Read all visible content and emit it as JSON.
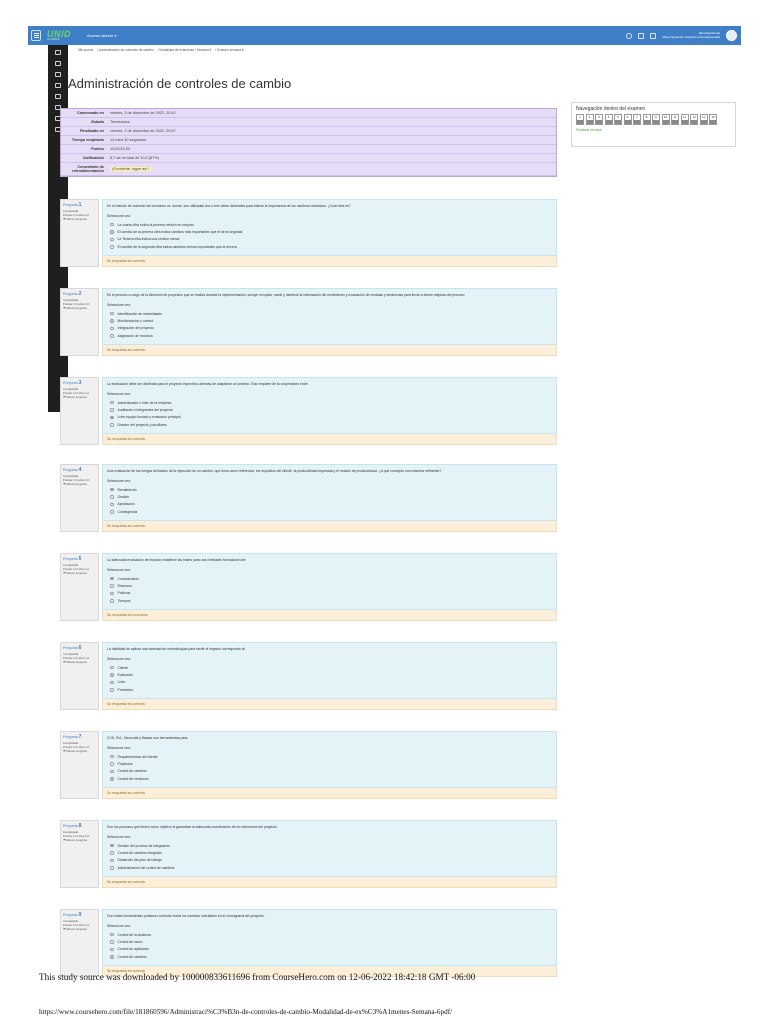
{
  "topnav": {
    "logo": "UNID",
    "logo_sub": "ALUMNOS",
    "direct_access": "Acceso directo ▾",
    "user_name": "Mis Asignaturas",
    "user_sub": "Mayo Navarrete Jessica Lorena Esmeralda"
  },
  "breadcrumb": [
    "Mis cursos",
    "Administración de controles de cambio",
    "Modalidad de exámenes / Semana 6",
    "Examen semana 6"
  ],
  "page_title": "Administración de controles de cambio",
  "summary": [
    {
      "k": "Comenzado en",
      "v": "viernes, 2 de diciembre de 2022, 20:42"
    },
    {
      "k": "Estado",
      "v": "Terminados"
    },
    {
      "k": "Finalizado en",
      "v": "viernes, 2 de diciembre de 2022, 20:57"
    },
    {
      "k": "Tiempo empleado",
      "v": "14 mins 40 segundos"
    },
    {
      "k": "Puntos",
      "v": "13,00/15,00"
    },
    {
      "k": "Calificación",
      "v": "8,7 de un total de 10,0 (87%)"
    },
    {
      "k": "Comentario de retroalimentación",
      "v": "¡Excelente, sigue así !"
    }
  ],
  "quiz_nav": {
    "title": "Navegación dentro del examen",
    "buttons": [
      "1",
      "2",
      "3",
      "4",
      "5",
      "6",
      "7",
      "8",
      "9",
      "10",
      "11",
      "12",
      "13",
      "14",
      "15"
    ],
    "finish": "Finalizar revisión"
  },
  "labels": {
    "question": "Pregunta",
    "complete": "Completada",
    "score": "Puntúa 1,0 sobre 1,0",
    "flag": "Marcar pregunta",
    "select_one": "Seleccione uno:"
  },
  "questions": [
    {
      "num": "1",
      "text": "En el método de numerar las versiones vs. donde, son utilizadas dos o tres cifras decimales para indicar la importancia de los cambios realizados. ¿Cuál cifra es?",
      "options": [
        "La cuarta cifra indica la primera versión en mejorar",
        "El cambio de la primera cifra indica cambios más importantes que el de la segunda",
        "La Tercera cifra indica una versión menor",
        "El cambio de la segunda cifra indica cambios menos importantes que la tercera"
      ],
      "selected": 1,
      "feedback": "Su respuesta es correcta."
    },
    {
      "num": "2",
      "text": "Es el proceso a cargo de la dirección de proyectos que se realiza durante la implementación, incluye recopilar, medir y distribuir la información del rendimiento y evaluación de medidas y tendencias para llevar a efecto mejoras del proceso.",
      "options": [
        "Identificación de necesidades",
        "Monitorización y control",
        "Integración del proyecto",
        "Asignación de recursos"
      ],
      "selected": 1,
      "feedback": "Su respuesta es correcta."
    },
    {
      "num": "3",
      "text": "La evaluación debe ser diseñada para el proyecto específico además de adaptarse al contexto. Esto requiere de la cooperación entre",
      "options": [
        "Administrador o líder de la empresa",
        "Auditando e integrantes del proyecto",
        "Líder equipo tomado y evaluador principal",
        "Director del proyecto y auxiliares"
      ],
      "selected": 2,
      "feedback": "Su respuesta es correcta."
    },
    {
      "num": "4",
      "text": "Una evaluación de los riesgos derivados de la ejecución de un cambio, que toma como referencia, los requisitos del cliente, la productividad esperada y el modelo de productividad. ¿A qué concepto nos estamos refiriendo?",
      "options": [
        "Rendimiento",
        "Gestión",
        "Aprobación",
        "Contingencia"
      ],
      "selected": 0,
      "feedback": "Su respuesta es correcta."
    },
    {
      "num": "5",
      "text": "La adecuada evaluación de impacto establece las bases para una certitudes formulación de:",
      "options": [
        "Comunicación",
        "Recursos",
        "Políticas",
        "Tiempos"
      ],
      "selected": 0,
      "feedback": "Su respuesta es incorrecta."
    },
    {
      "num": "6",
      "text": "La habilidad de aplicar una variedad de metodologías para medir el impacto corresponde al:",
      "options": [
        "Cliente",
        "Evaluador",
        "Líder",
        "Proveedor"
      ],
      "selected": 1,
      "feedback": "Su respuesta es correcta."
    },
    {
      "num": "7",
      "text": "CVS, SVL, Mercurial y Bazaar son herramientas para:",
      "options": [
        "Requerimientos del cliente",
        "Proyectos",
        "Control de cambios",
        "Control de versiones"
      ],
      "selected": 3,
      "feedback": "Su respuesta es correcta."
    },
    {
      "num": "8",
      "text": "Son los procesos que tienen como objetivo el garantizar la adecuada coordinación de los elementos del proyecto.",
      "options": [
        "Gestión del proceso de integración",
        "Control de cambios integrado",
        "Desarrollo del plan de trabajo",
        "Administración del control de cambios"
      ],
      "selected": 0,
      "feedback": "Su respuesta es correcta."
    },
    {
      "num": "9",
      "text": "Con estas herramientas podemos controlar todos los cambios solicitados en el cronograma del proyecto.",
      "options": [
        "Control de la auditoría",
        "Control de razón",
        "Control de aplicación",
        "Control de cambios"
      ],
      "selected": 3,
      "feedback": "Su respuesta es correcta."
    }
  ],
  "footer": {
    "source": "This study source was downloaded by 100000833611696 from CourseHero.com on 12-06-2022 18:42:18 GMT -06:00",
    "url": "https://www.coursehero.com/file/181860596/Administraci%C3%B3n-de-controles-de-cambio-Modalidad-de-ex%C3%A1menes-Semana-6pdf/"
  }
}
